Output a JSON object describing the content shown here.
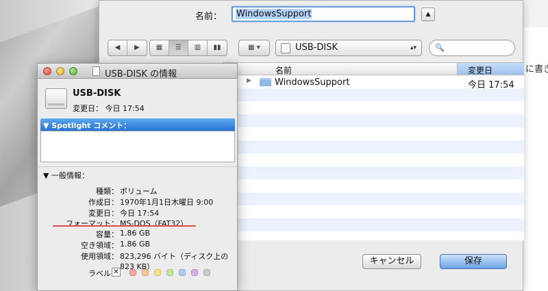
{
  "background": {
    "doc_text": "に書き"
  },
  "save_dialog": {
    "name_label": "名前：",
    "filename": "WindowsSupport",
    "toolbar": {
      "back": "◀",
      "forward": "▶",
      "arrange": "▦ ▾",
      "location": "USB-DISK",
      "location_arrow": "▴▾",
      "search_glyph": "🔍"
    },
    "columns": {
      "name": "名前",
      "date": "変更日"
    },
    "files": [
      {
        "name": "WindowsSupport",
        "date": "今日 17:54"
      }
    ],
    "cancel_label": "キャンセル",
    "save_label": "保存"
  },
  "info_window": {
    "title": "USB-DISK の情報",
    "disk_name": "USB-DISK",
    "modified_summary": "変更日： 今日 17:54",
    "spotlight_header": "▼ Spotlight コメント：",
    "general_header": "▼ 一般情報：",
    "rows": [
      {
        "label": "種類：",
        "value": "ボリューム"
      },
      {
        "label": "作成日：",
        "value": "1970年1月1日木曜日 9:00"
      },
      {
        "label": "変更日：",
        "value": "今日 17:54"
      },
      {
        "label": "フォーマット：",
        "value": "MS-DOS（FAT32）"
      },
      {
        "label": "容量：",
        "value": "1.86 GB"
      },
      {
        "label": "空き領域：",
        "value": "1.86 GB"
      },
      {
        "label": "使用領域：",
        "value": "823,296 バイト（ディスク上の"
      },
      {
        "label": "",
        "value": "823 KB）"
      }
    ],
    "label_caption": "ラベル：",
    "label_none": "✕",
    "label_colors": [
      "#f4a6a0",
      "#f6c692",
      "#f3e08e",
      "#c5e59a",
      "#a9c9f2",
      "#d6b1e8",
      "#c9c9c9"
    ]
  },
  "colors": {
    "selection": "#b3d3f7",
    "accent": "#2773d6",
    "format_underline": "#d94b4b"
  }
}
